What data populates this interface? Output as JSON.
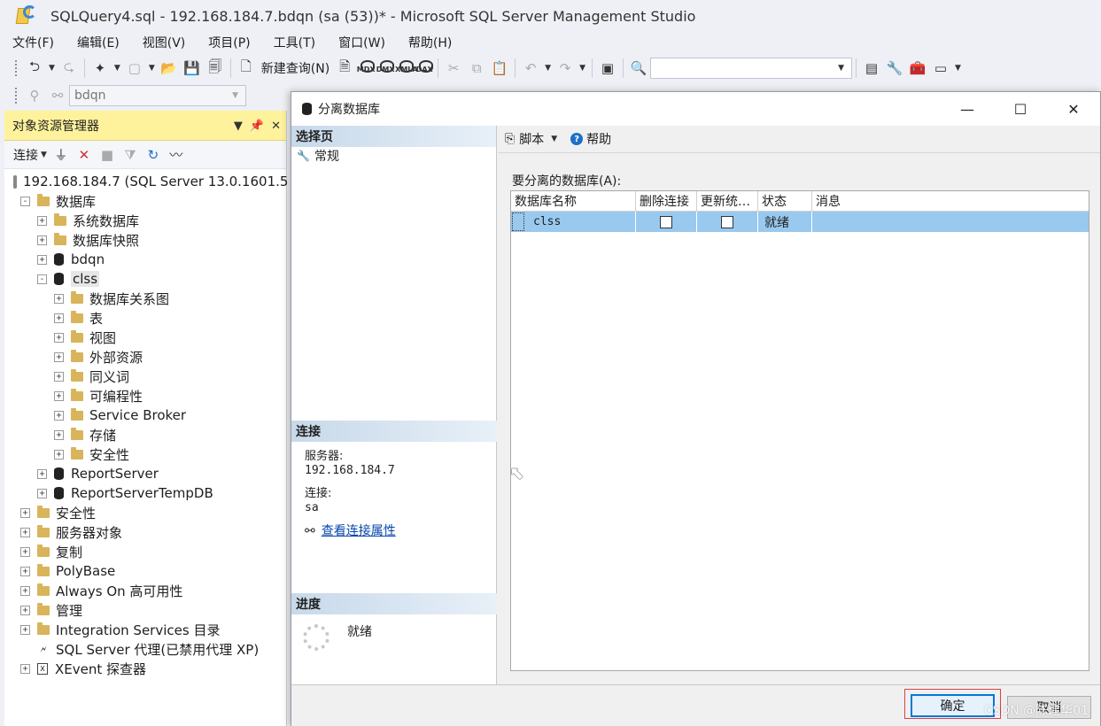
{
  "window": {
    "title": "SQLQuery4.sql - 192.168.184.7.bdqn (sa (53))* - Microsoft SQL Server Management Studio"
  },
  "menu": [
    "文件(F)",
    "编辑(E)",
    "视图(V)",
    "项目(P)",
    "工具(T)",
    "窗口(W)",
    "帮助(H)"
  ],
  "toolbar1": {
    "new_query": "新建查询(N)",
    "mini_icons": [
      "MDX",
      "DMX",
      "XMLA",
      "DAX"
    ]
  },
  "toolbar2": {
    "database_combo": "bdqn"
  },
  "object_explorer": {
    "title": "对象资源管理器",
    "connect": "连接",
    "tree": [
      {
        "label": "192.168.184.7 (SQL Server 13.0.1601.5",
        "level": 0,
        "icon": "server-icon",
        "exp": "-"
      },
      {
        "label": "数据库",
        "level": 1,
        "icon": "folder-icon",
        "exp": "-"
      },
      {
        "label": "系统数据库",
        "level": 2,
        "icon": "folder-icon",
        "exp": "+"
      },
      {
        "label": "数据库快照",
        "level": 2,
        "icon": "folder-icon",
        "exp": "+"
      },
      {
        "label": "bdqn",
        "level": 2,
        "icon": "database-icon",
        "exp": "+"
      },
      {
        "label": "clss",
        "level": 2,
        "icon": "database-icon",
        "exp": "-",
        "selected": true
      },
      {
        "label": "数据库关系图",
        "level": 3,
        "icon": "folder-icon",
        "exp": "+"
      },
      {
        "label": "表",
        "level": 3,
        "icon": "folder-icon",
        "exp": "+"
      },
      {
        "label": "视图",
        "level": 3,
        "icon": "folder-icon",
        "exp": "+"
      },
      {
        "label": "外部资源",
        "level": 3,
        "icon": "folder-icon",
        "exp": "+"
      },
      {
        "label": "同义词",
        "level": 3,
        "icon": "folder-icon",
        "exp": "+"
      },
      {
        "label": "可编程性",
        "level": 3,
        "icon": "folder-icon",
        "exp": "+"
      },
      {
        "label": "Service Broker",
        "level": 3,
        "icon": "folder-icon",
        "exp": "+"
      },
      {
        "label": "存储",
        "level": 3,
        "icon": "folder-icon",
        "exp": "+"
      },
      {
        "label": "安全性",
        "level": 3,
        "icon": "folder-icon",
        "exp": "+"
      },
      {
        "label": "ReportServer",
        "level": 2,
        "icon": "database-icon",
        "exp": "+"
      },
      {
        "label": "ReportServerTempDB",
        "level": 2,
        "icon": "database-icon",
        "exp": "+"
      },
      {
        "label": "安全性",
        "level": 1,
        "icon": "folder-icon",
        "exp": "+"
      },
      {
        "label": "服务器对象",
        "level": 1,
        "icon": "folder-icon",
        "exp": "+"
      },
      {
        "label": "复制",
        "level": 1,
        "icon": "folder-icon",
        "exp": "+"
      },
      {
        "label": "PolyBase",
        "level": 1,
        "icon": "folder-icon",
        "exp": "+"
      },
      {
        "label": "Always On 高可用性",
        "level": 1,
        "icon": "folder-icon",
        "exp": "+"
      },
      {
        "label": "管理",
        "level": 1,
        "icon": "folder-icon",
        "exp": "+"
      },
      {
        "label": "Integration Services 目录",
        "level": 1,
        "icon": "folder-icon",
        "exp": "+"
      },
      {
        "label": "SQL Server 代理(已禁用代理 XP)",
        "level": 1,
        "icon": "agent-icon",
        "exp": ""
      },
      {
        "label": "XEvent 探查器",
        "level": 1,
        "icon": "xevent-icon",
        "exp": "+"
      }
    ]
  },
  "dialog": {
    "title": "分离数据库",
    "select_page": "选择页",
    "pages": [
      "常规"
    ],
    "toolbar": {
      "script": "脚本",
      "help": "帮助"
    },
    "grid_label": "要分离的数据库(A):",
    "columns": [
      "数据库名称",
      "删除连接",
      "更新统…",
      "状态",
      "消息"
    ],
    "rows": [
      {
        "name": "clss",
        "drop_connections": false,
        "update_stats": false,
        "status": "就绪",
        "message": ""
      }
    ],
    "connection": {
      "header": "连接",
      "server_label": "服务器:",
      "server": "192.168.184.7",
      "conn_label": "连接:",
      "user": "sa",
      "view_link": "查看连接属性"
    },
    "progress": {
      "header": "进度",
      "status": "就绪"
    },
    "ok": "确定",
    "cancel": "取消"
  },
  "watermark": "CSDN @陈建华01",
  "colors": {
    "oe_header": "#fff29d",
    "grid_selection": "#99c9ef",
    "ok_border": "#0078d7",
    "highlight_box": "#d8434b"
  }
}
